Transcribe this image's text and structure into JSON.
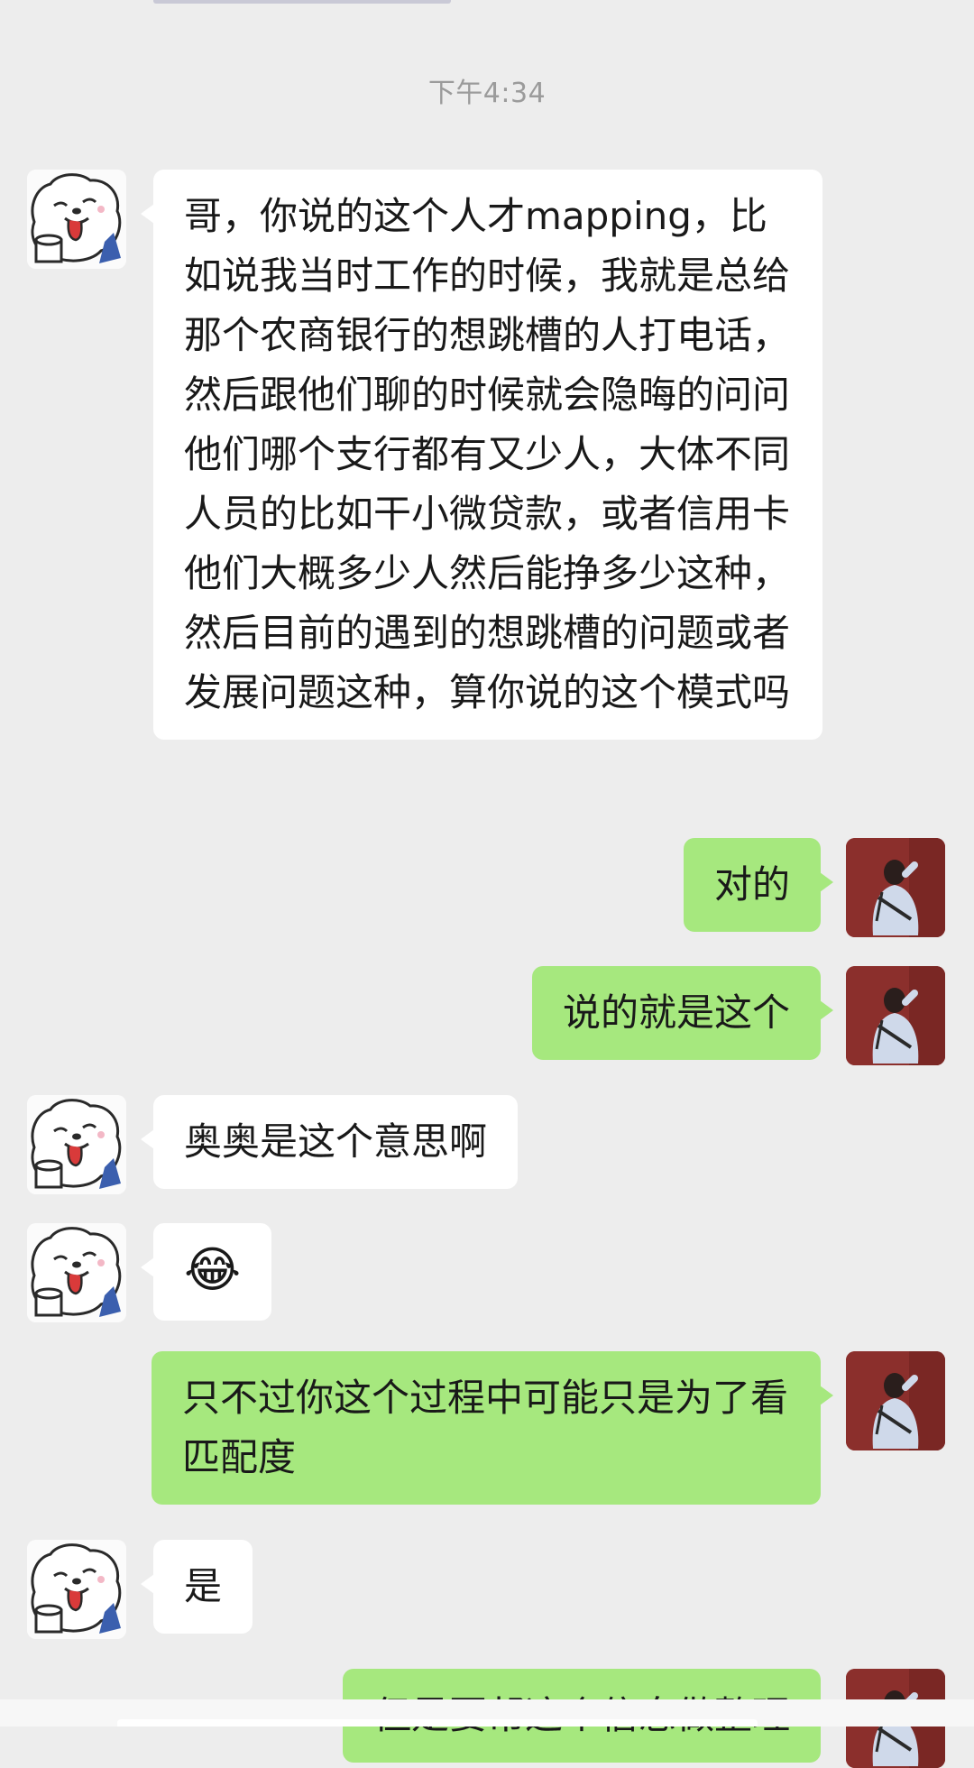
{
  "chat": {
    "timestamp": "下午4:34",
    "messages": [
      {
        "from": "contact",
        "type": "text",
        "text": "哥，你说的这个人才mapping，比如说我当时工作的时候，我就是总给那个农商银行的想跳槽的人打电话，然后跟他们聊的时候就会隐晦的问问他们哪个支行都有又少人，大体不同人员的比如干小微贷款，或者信用卡他们大概多少人然后能挣多少这种，然后目前的遇到的想跳槽的问题或者发展问题这种，算你说的这个模式吗"
      },
      {
        "from": "me",
        "type": "text",
        "text": "对的"
      },
      {
        "from": "me",
        "type": "text",
        "text": "说的就是这个"
      },
      {
        "from": "contact",
        "type": "text",
        "text": "奥奥是这个意思啊"
      },
      {
        "from": "contact",
        "type": "emoji",
        "text": "😂"
      },
      {
        "from": "me",
        "type": "text",
        "text": "只不过你这个过程中可能只是为了看匹配度"
      },
      {
        "from": "contact",
        "type": "text",
        "text": "是"
      },
      {
        "from": "me",
        "type": "text",
        "text": "但是要帮这个信息做整理"
      }
    ]
  },
  "colors": {
    "background": "#ededed",
    "incoming_bubble": "#ffffff",
    "outgoing_bubble": "#a6e87e",
    "timestamp_text": "#9b9b9b"
  },
  "icons": {
    "contact_avatar": "white-fluffy-dog-avatar",
    "my_avatar": "person-back-view-avatar"
  }
}
